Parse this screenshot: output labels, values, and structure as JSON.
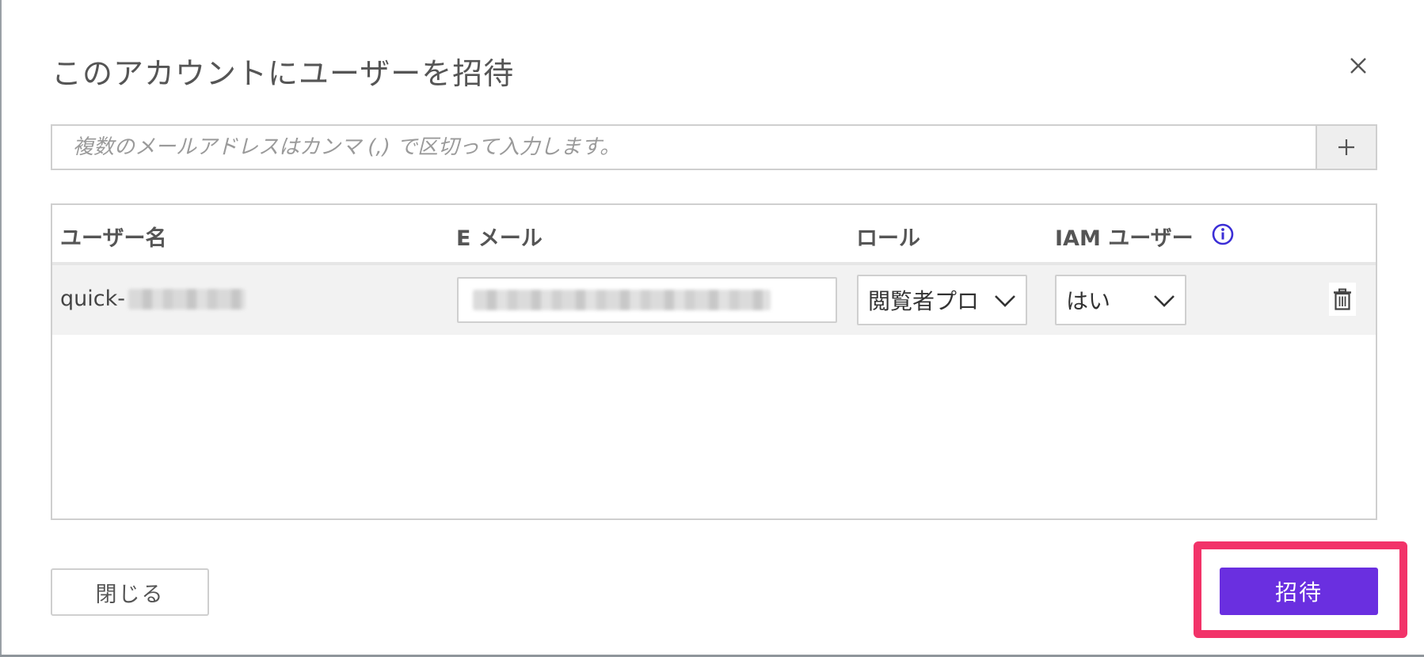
{
  "dialog": {
    "title": "このアカウントにユーザーを招待",
    "email_input": {
      "value": "",
      "placeholder": "複数のメールアドレスはカンマ (,) で区切って入力します。"
    },
    "add_label": "+",
    "table": {
      "headers": {
        "username": "ユーザー名",
        "email": "E メール",
        "role": "ロール",
        "iam_user": "IAM ユーザー"
      },
      "rows": [
        {
          "username_prefix": "quick-",
          "role": "閲覧者プロ",
          "iam_user": "はい"
        }
      ]
    },
    "footer": {
      "close_label": "閉じる",
      "invite_label": "招待"
    }
  },
  "colors": {
    "accent": "#6a2fe0",
    "highlight": "#f23369",
    "info_icon": "#3b2ed6"
  },
  "icons": [
    "close-icon",
    "plus-icon",
    "info-icon",
    "chevron-down-icon",
    "trash-icon"
  ]
}
